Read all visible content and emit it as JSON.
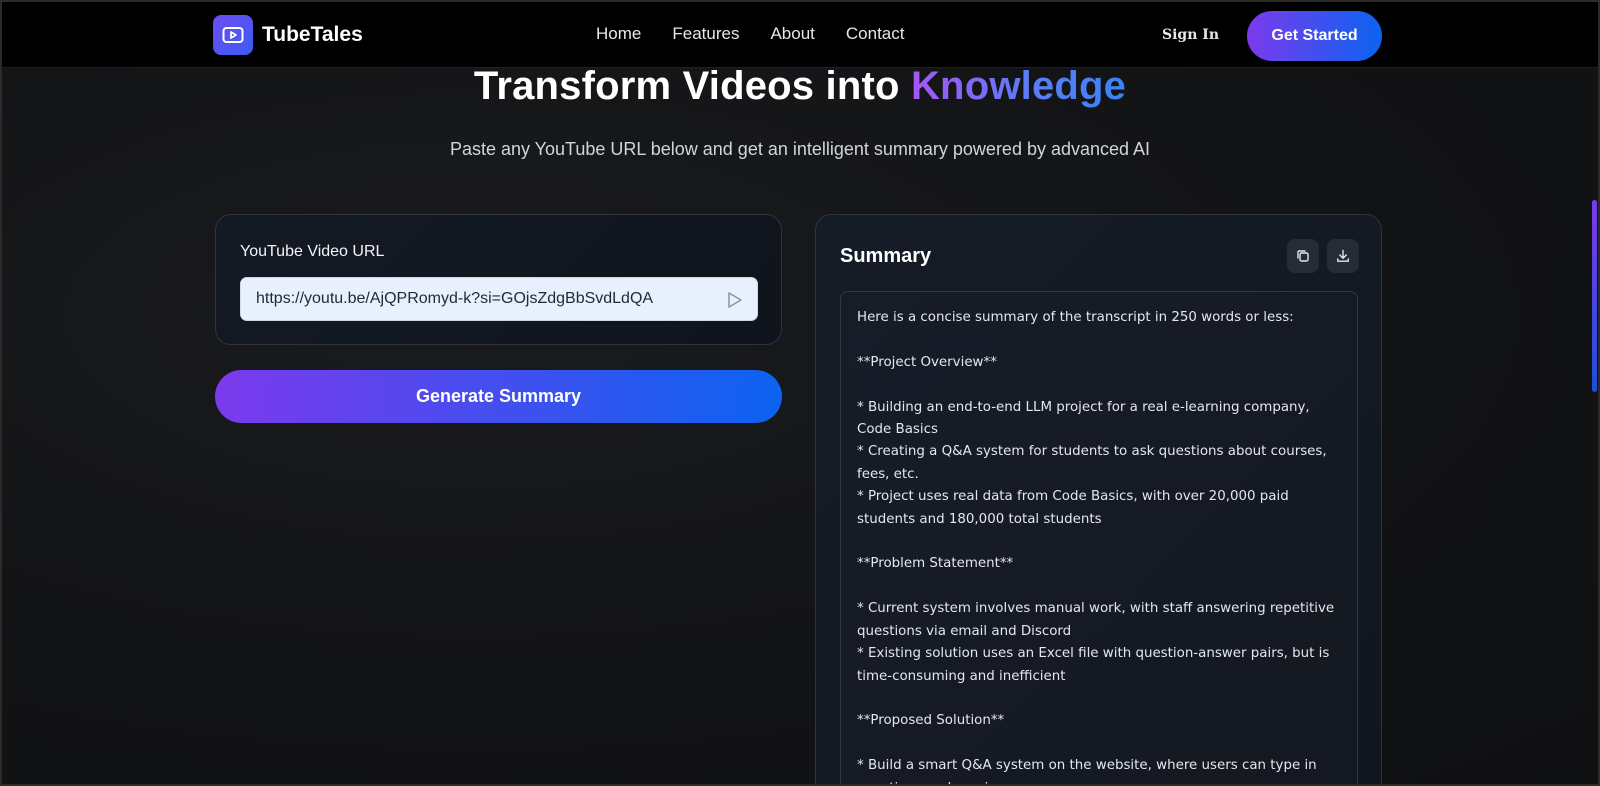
{
  "brand": {
    "name": "TubeTales",
    "logo_icon": "play-icon"
  },
  "nav": {
    "links": [
      "Home",
      "Features",
      "About",
      "Contact"
    ],
    "sign_in": "Sign In",
    "get_started": "Get Started"
  },
  "hero": {
    "title_main": "Transform Videos into ",
    "title_accent": "Knowledge",
    "subtitle": "Paste any YouTube URL below and get an intelligent summary powered by advanced AI"
  },
  "input_card": {
    "label": "YouTube Video URL",
    "url_value": "https://youtu.be/AjQPRomyd-k?si=GOjsZdgBbSvdLdQA",
    "send_icon": "send-icon"
  },
  "generate_button": "Generate Summary",
  "summary": {
    "title": "Summary",
    "copy_icon": "copy-icon",
    "download_icon": "download-icon",
    "text": "Here is a concise summary of the transcript in 250 words or less:\n\n**Project Overview**\n\n* Building an end-to-end LLM project for a real e-learning company, Code Basics\n* Creating a Q&A system for students to ask questions about courses, fees, etc.\n* Project uses real data from Code Basics, with over 20,000 paid students and 180,000 total students\n\n**Problem Statement**\n\n* Current system involves manual work, with staff answering repetitive questions via email and Discord\n* Existing solution uses an Excel file with question-answer pairs, but is time-consuming and inefficient\n\n**Proposed Solution**\n\n* Build a smart Q&A system on the website, where users can type in questions and receive answers"
  },
  "colors": {
    "accent_purple": "#7c3aed",
    "accent_blue": "#0b63f0",
    "background": "#111214"
  }
}
